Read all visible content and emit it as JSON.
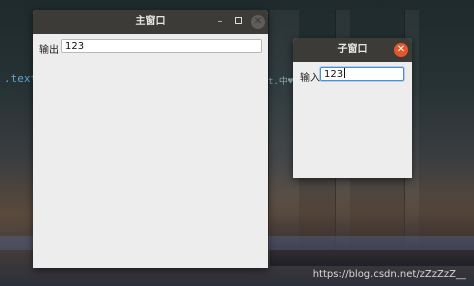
{
  "desktop": {
    "code_text": ".text",
    "code_text2": "t.中♥0",
    "watermark": "https://blog.csdn.net/zZzZzZ__"
  },
  "main_window": {
    "title": "主窗口",
    "minimize_icon": "minimize-icon",
    "maximize_icon": "maximize-icon",
    "close_icon": "close-icon",
    "output_label": "输出",
    "output_value": "123"
  },
  "child_window": {
    "title": "子窗口",
    "close_icon": "close-icon",
    "input_label": "输入",
    "input_value": "123"
  },
  "colors": {
    "titlebar": "#3c3b37",
    "window_body": "#ededed",
    "close_active": "#e2582c",
    "focus_border": "#4a90d9"
  }
}
